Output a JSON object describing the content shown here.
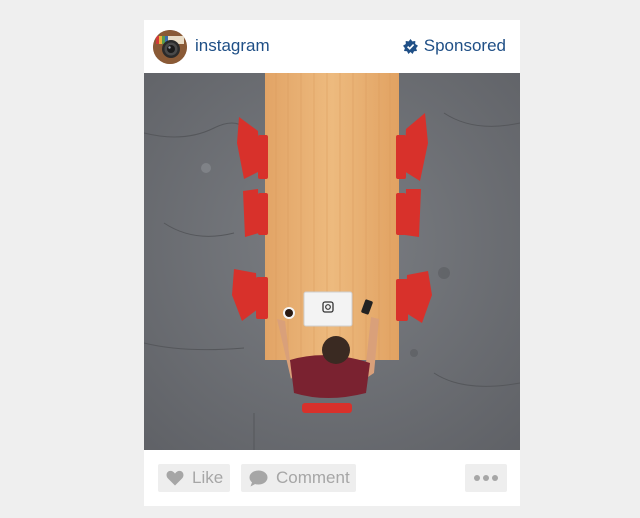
{
  "post": {
    "username": "instagram",
    "sponsored_label": "Sponsored"
  },
  "actions": {
    "like_label": "Like",
    "comment_label": "Comment"
  },
  "icons": {
    "avatar": "instagram-camera-logo",
    "sponsored": "sponsored-badge-icon",
    "like": "heart-icon",
    "comment": "speech-bubble-icon",
    "more": "ellipsis-icon"
  },
  "colors": {
    "link_blue": "#1f4f86",
    "button_bg": "#eeeeee",
    "button_text": "#a6a6a6",
    "page_bg": "#efefef"
  }
}
